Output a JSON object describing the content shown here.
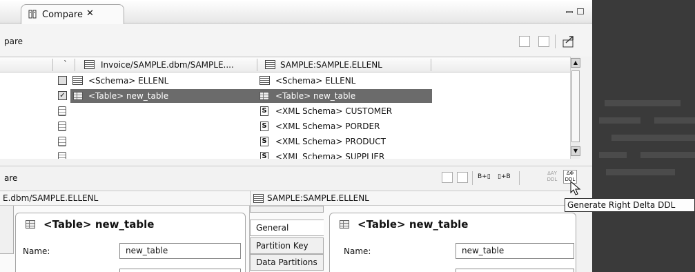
{
  "editor": {
    "tab_label": "Compare",
    "close_glyph": "✕"
  },
  "structure_compare": {
    "title": "pare",
    "columns": [
      "`",
      "Invoice/SAMPLE.dbm/SAMPLE....",
      "SAMPLE:SAMPLE.ELLENL"
    ],
    "rows": [
      {
        "left": "<Schema> ELLENL",
        "right": "<Schema> ELLENL",
        "selected": false
      },
      {
        "left": "<Table> new_table",
        "right": "<Table> new_table",
        "selected": true
      },
      {
        "left": "",
        "right": "<XML Schema> CUSTOMER",
        "selected": false
      },
      {
        "left": "",
        "right": "<XML Schema> PORDER",
        "selected": false
      },
      {
        "left": "",
        "right": "<XML Schema> PRODUCT",
        "selected": false
      },
      {
        "left": "",
        "right": "<XML Schema> SUPPLIER",
        "selected": false
      }
    ]
  },
  "property_compare": {
    "title": "are",
    "toolbar": {
      "copy_left": "B+▯",
      "copy_right": "▯+B",
      "left_ddl": "ΔΑΥ DDL",
      "right_ddl": "ΔΦ DDL"
    },
    "left_pane": {
      "header": "E.dbm/SAMPLE.ELLENL",
      "card_title": "<Table> new_table",
      "name_label": "Name:",
      "name_value": "new_table"
    },
    "right_pane": {
      "header": "SAMPLE:SAMPLE.ELLENL",
      "tabs": [
        "General",
        "Partition Key",
        "Data Partitions"
      ],
      "card_title": "<Table> new_table",
      "name_label": "Name:",
      "name_value": "new_table"
    }
  },
  "tooltip": "Generate Right Delta DDL"
}
